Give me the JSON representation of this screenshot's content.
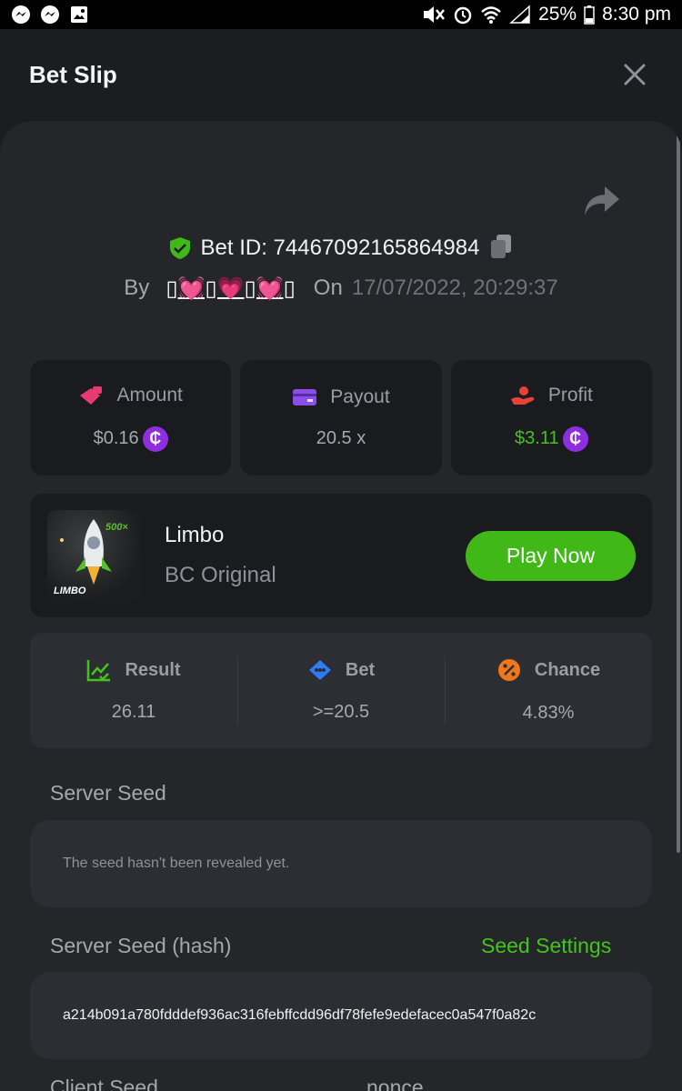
{
  "status_bar": {
    "battery": "25%",
    "time": "8:30 pm"
  },
  "header": {
    "title": "Bet Slip"
  },
  "bet": {
    "id_text": "Bet ID: 74467092165864984",
    "by_label": "By",
    "user": "▯💓▯💗▯💓▯",
    "on_label": "On",
    "datetime": "17/07/2022, 20:29:37"
  },
  "stats": {
    "amount_label": "Amount",
    "amount_value": "$0.16",
    "payout_label": "Payout",
    "payout_value": "20.5 x",
    "profit_label": "Profit",
    "profit_value": "$3.11",
    "coin_symbol": "₵",
    "profit_color": "#43c41a"
  },
  "game": {
    "name": "Limbo",
    "category": "BC Original",
    "thumb_label": "LIMBO",
    "thumb_multiplier": "500×",
    "play_label": "Play Now"
  },
  "results": {
    "result_label": "Result",
    "result_value": "26.11",
    "bet_label": "Bet",
    "bet_value": ">=20.5",
    "chance_label": "Chance",
    "chance_value": "4.83%"
  },
  "seeds": {
    "server_seed_label": "Server Seed",
    "server_seed_note": "The seed hasn't been revealed yet.",
    "server_hash_label": "Server Seed (hash)",
    "seed_settings_label": "Seed Settings",
    "server_hash_value": "a214b091a780fdddef936ac316febffcdd96df78fefe9edefacec0a547f0a82c",
    "client_seed_label": "Client Seed",
    "nonce_label": "nonce"
  },
  "colors": {
    "accent_green": "#3fb818",
    "coin_purple": "#8d2fe0"
  }
}
